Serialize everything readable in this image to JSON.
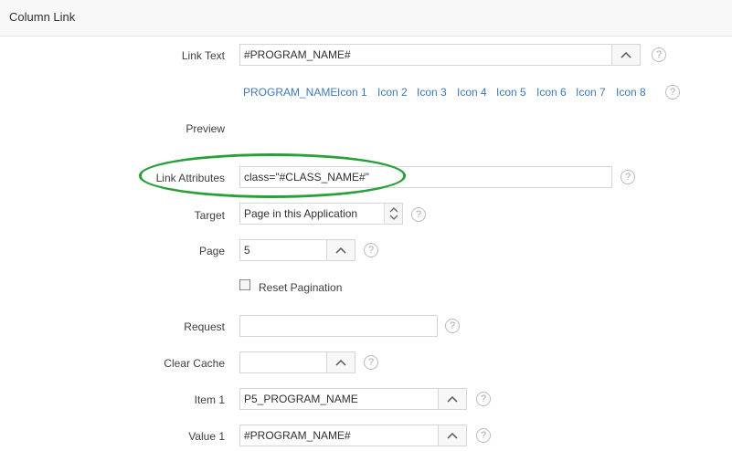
{
  "header": {
    "title": "Column Link"
  },
  "form": {
    "link_text": {
      "label": "Link Text",
      "value": "#PROGRAM_NAME#"
    },
    "substitutions": [
      "PROGRAM_NAME",
      "Icon 1",
      "Icon 2",
      "Icon 3",
      "Icon 4",
      "Icon 5",
      "Icon 6",
      "Icon 7",
      "Icon 8"
    ],
    "preview": {
      "label": "Preview"
    },
    "link_attributes": {
      "label": "Link Attributes",
      "value": "class=\"#CLASS_NAME#\""
    },
    "target": {
      "label": "Target",
      "value": "Page in this Application"
    },
    "page": {
      "label": "Page",
      "value": "5"
    },
    "reset_pagination": {
      "label": "Reset Pagination",
      "checked": false
    },
    "request": {
      "label": "Request",
      "value": ""
    },
    "clear_cache": {
      "label": "Clear Cache",
      "value": ""
    },
    "item1": {
      "label": "Item 1",
      "value": "P5_PROGRAM_NAME"
    },
    "value1": {
      "label": "Value 1",
      "value": "#PROGRAM_NAME#"
    },
    "help_glyph": "?"
  },
  "colors": {
    "link": "#3f78b8",
    "highlight": "#28a038",
    "border": "#d6d6d6"
  },
  "icons": {
    "chevron": "chevron-up-icon",
    "help": "help-icon",
    "select": "up-down-arrows-icon"
  }
}
